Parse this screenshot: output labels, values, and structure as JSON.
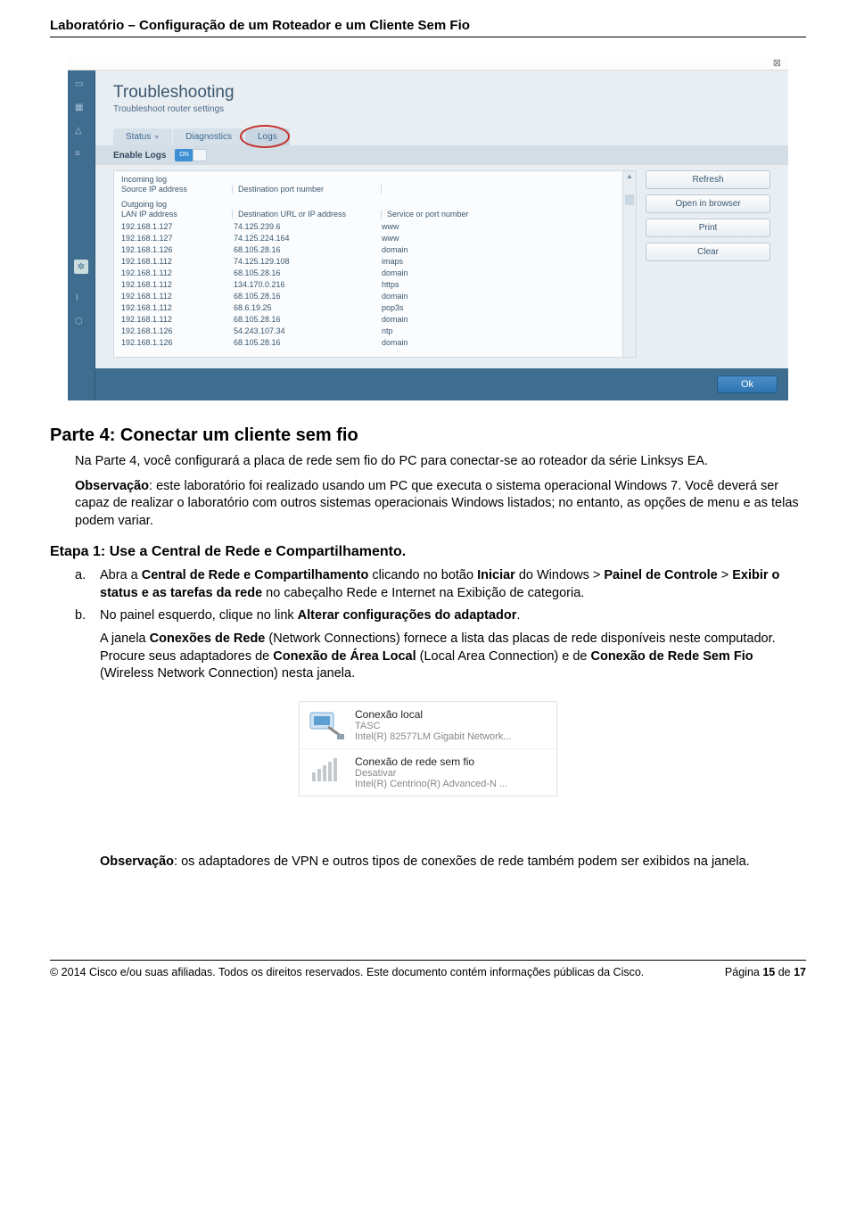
{
  "doc": {
    "header": "Laboratório  –  Configuração de um Roteador e um Cliente Sem Fio",
    "part4_title": "Parte 4: Conectar um cliente sem fio",
    "part4_intro": "Na Parte 4, você configurará a placa de rede sem fio do PC para conectar-se ao roteador da série Linksys EA.",
    "obs1_prefix": "Observação",
    "obs1_text": ": este laboratório foi realizado usando um PC que executa o sistema operacional Windows 7. Você deverá ser capaz de realizar o laboratório com outros sistemas operacionais Windows listados; no entanto, as opções de menu e as telas podem variar.",
    "etapa1_title": "Etapa 1:  Use a Central de Rede e Compartilhamento.",
    "item_a_marker": "a.",
    "item_a_p1": "Abra a ",
    "item_a_b1": "Central de Rede e Compartilhamento",
    "item_a_p2": " clicando no botão ",
    "item_a_b2": "Iniciar",
    "item_a_p3": " do Windows > ",
    "item_a_b3": "Painel de Controle",
    "item_a_p4": " > ",
    "item_a_b4": "Exibir o status e as tarefas da rede",
    "item_a_p5": " no cabeçalho Rede e Internet na Exibição de categoria.",
    "item_b_marker": "b.",
    "item_b_p1": "No painel esquerdo, clique no link ",
    "item_b_b1": "Alterar configurações do adaptador",
    "item_b_p2": ".",
    "item_b_sub_p1": "A janela ",
    "item_b_sub_b1": "Conexões de Rede",
    "item_b_sub_p2": " (Network Connections) fornece a lista das placas de rede disponíveis neste computador. Procure seus adaptadores de ",
    "item_b_sub_b2": "Conexão de Área Local",
    "item_b_sub_p3": " (Local Area Connection) e de ",
    "item_b_sub_b3": "Conexão de Rede Sem Fio",
    "item_b_sub_p4": " (Wireless Network Connection) nesta janela.",
    "obs2_prefix": "Observação",
    "obs2_text": ": os adaptadores de VPN e outros tipos de conexões de rede também podem ser exibidos na janela.",
    "footer_left": "© 2014 Cisco e/ou suas afiliadas. Todos os direitos reservados. Este documento contém informações públicas da Cisco.",
    "footer_right_p": "Página ",
    "footer_right_n": "15",
    "footer_right_de": " de ",
    "footer_right_t": "17"
  },
  "router": {
    "title": "Troubleshooting",
    "subtitle": "Troubleshoot router settings",
    "tabs": {
      "status": "Status",
      "diagnostics": "Diagnostics",
      "logs": "Logs"
    },
    "enable_label": "Enable Logs",
    "toggle_text": "ON",
    "incoming_label": "Incoming log",
    "incoming_h1": "Source IP address",
    "incoming_h2": "Destination port number",
    "outgoing_label": "Outgoing log",
    "outgoing_h1": "LAN IP address",
    "outgoing_h2": "Destination URL or IP address",
    "outgoing_h3": "Service or port number",
    "rows": [
      {
        "c1": "192.168.1.127",
        "c2": "74.125.239.6",
        "c3": "www"
      },
      {
        "c1": "192.168.1.127",
        "c2": "74.125.224.164",
        "c3": "www"
      },
      {
        "c1": "192.168.1.126",
        "c2": "68.105.28.16",
        "c3": "domain"
      },
      {
        "c1": "192.168.1.112",
        "c2": "74.125.129.108",
        "c3": "imaps"
      },
      {
        "c1": "192.168.1.112",
        "c2": "68.105.28.16",
        "c3": "domain"
      },
      {
        "c1": "192.168.1.112",
        "c2": "134.170.0.216",
        "c3": "https"
      },
      {
        "c1": "192.168.1.112",
        "c2": "68.105.28.16",
        "c3": "domain"
      },
      {
        "c1": "192.168.1.112",
        "c2": "68.6.19.25",
        "c3": "pop3s"
      },
      {
        "c1": "192.168.1.112",
        "c2": "68.105.28.16",
        "c3": "domain"
      },
      {
        "c1": "192.168.1.126",
        "c2": "54.243.107.34",
        "c3": "ntp"
      },
      {
        "c1": "192.168.1.126",
        "c2": "68.105.28.16",
        "c3": "domain"
      }
    ],
    "buttons": {
      "refresh": "Refresh",
      "open": "Open in browser",
      "print": "Print",
      "clear": "Clear"
    },
    "ok": "Ok"
  },
  "winconn": {
    "row1": {
      "t1": "Conexão local",
      "t2": "TASC",
      "t3": "Intel(R) 82577LM Gigabit Network..."
    },
    "row2": {
      "t1": "Conexão de rede sem fio",
      "t2": "Desativar",
      "t3": "Intel(R) Centrino(R) Advanced-N ..."
    }
  },
  "chart_data": {
    "type": "table",
    "title": "Outgoing log",
    "columns": [
      "LAN IP address",
      "Destination URL or IP address",
      "Service or port number"
    ],
    "rows": [
      [
        "192.168.1.127",
        "74.125.239.6",
        "www"
      ],
      [
        "192.168.1.127",
        "74.125.224.164",
        "www"
      ],
      [
        "192.168.1.126",
        "68.105.28.16",
        "domain"
      ],
      [
        "192.168.1.112",
        "74.125.129.108",
        "imaps"
      ],
      [
        "192.168.1.112",
        "68.105.28.16",
        "domain"
      ],
      [
        "192.168.1.112",
        "134.170.0.216",
        "https"
      ],
      [
        "192.168.1.112",
        "68.105.28.16",
        "domain"
      ],
      [
        "192.168.1.112",
        "68.6.19.25",
        "pop3s"
      ],
      [
        "192.168.1.112",
        "68.105.28.16",
        "domain"
      ],
      [
        "192.168.1.126",
        "54.243.107.34",
        "ntp"
      ],
      [
        "192.168.1.126",
        "68.105.28.16",
        "domain"
      ]
    ]
  }
}
